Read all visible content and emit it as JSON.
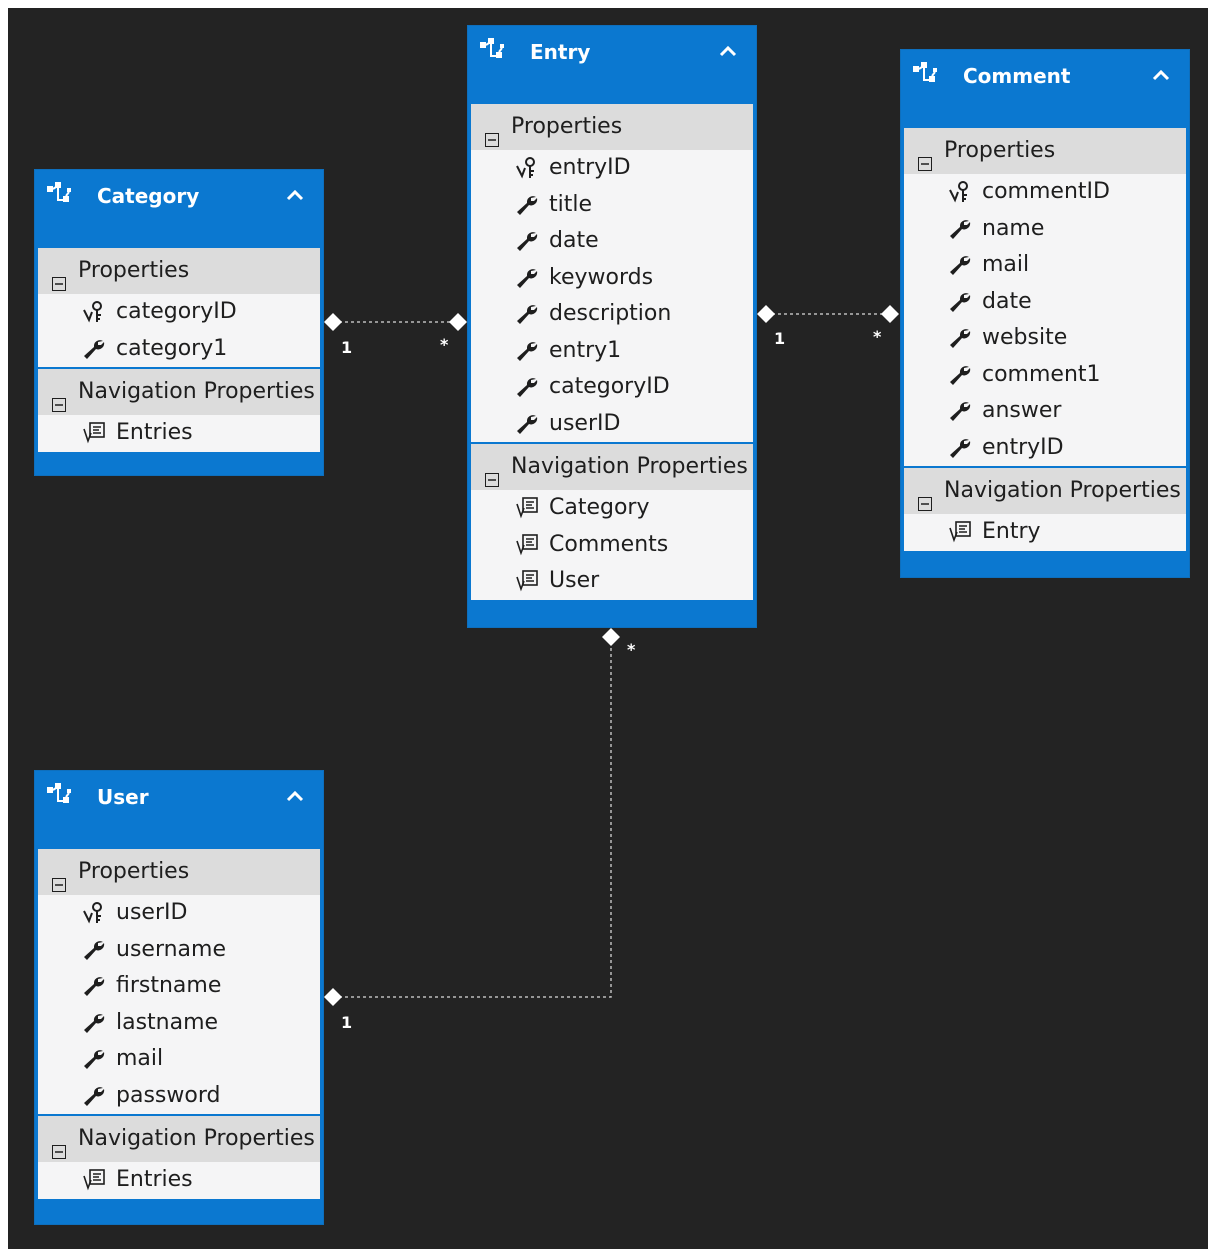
{
  "colors": {
    "canvas": "#232323",
    "header": "#0b78d0",
    "section": "#dcdcdc",
    "body": "#f5f5f6",
    "text": "#1e1e1e"
  },
  "icons": {
    "entity": "entity-icon",
    "key": "key-icon",
    "property": "wrench-icon",
    "navigation": "navigation-icon",
    "collapse": "chevron-up-icon",
    "toggle": "minus-box-icon"
  },
  "entities": {
    "category": {
      "title": "Category",
      "properties_label": "Properties",
      "properties": [
        {
          "name": "categoryID",
          "key": true
        },
        {
          "name": "category1",
          "key": false
        }
      ],
      "navigation_label": "Navigation Properties",
      "navigation": [
        "Entries"
      ]
    },
    "entry": {
      "title": "Entry",
      "properties_label": "Properties",
      "properties": [
        {
          "name": "entryID",
          "key": true
        },
        {
          "name": "title",
          "key": false
        },
        {
          "name": "date",
          "key": false
        },
        {
          "name": "keywords",
          "key": false
        },
        {
          "name": "description",
          "key": false
        },
        {
          "name": "entry1",
          "key": false
        },
        {
          "name": "categoryID",
          "key": false
        },
        {
          "name": "userID",
          "key": false
        }
      ],
      "navigation_label": "Navigation Properties",
      "navigation": [
        "Category",
        "Comments",
        "User"
      ]
    },
    "comment": {
      "title": "Comment",
      "properties_label": "Properties",
      "properties": [
        {
          "name": "commentID",
          "key": true
        },
        {
          "name": "name",
          "key": false
        },
        {
          "name": "mail",
          "key": false
        },
        {
          "name": "date",
          "key": false
        },
        {
          "name": "website",
          "key": false
        },
        {
          "name": "comment1",
          "key": false
        },
        {
          "name": "answer",
          "key": false
        },
        {
          "name": "entryID",
          "key": false
        }
      ],
      "navigation_label": "Navigation Properties",
      "navigation": [
        "Entry"
      ]
    },
    "user": {
      "title": "User",
      "properties_label": "Properties",
      "properties": [
        {
          "name": "userID",
          "key": true
        },
        {
          "name": "username",
          "key": false
        },
        {
          "name": "firstname",
          "key": false
        },
        {
          "name": "lastname",
          "key": false
        },
        {
          "name": "mail",
          "key": false
        },
        {
          "name": "password",
          "key": false
        }
      ],
      "navigation_label": "Navigation Properties",
      "navigation": [
        "Entries"
      ]
    }
  },
  "associations": {
    "category_entry": {
      "one": "1",
      "many": "*"
    },
    "entry_comment": {
      "one": "1",
      "many": "*"
    },
    "user_entry": {
      "one": "1",
      "many": "*"
    }
  }
}
